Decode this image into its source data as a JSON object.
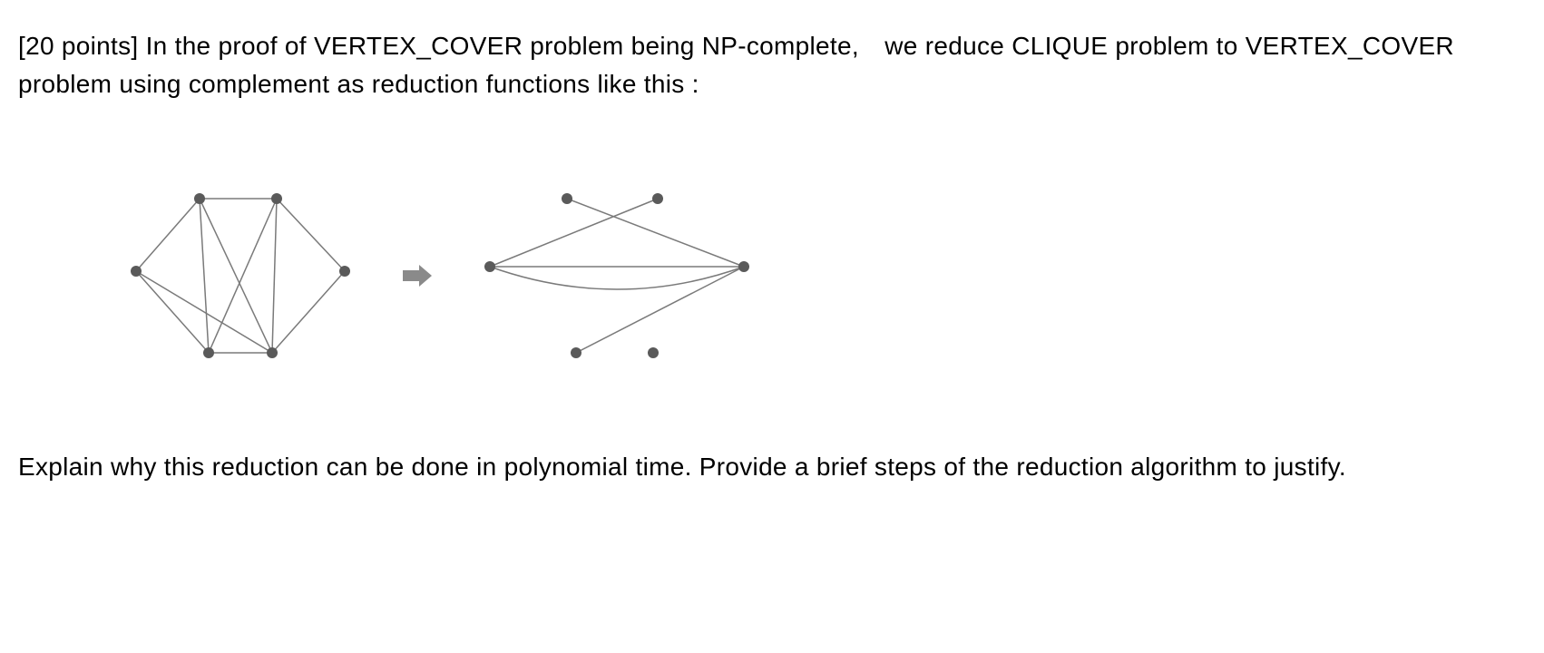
{
  "question": {
    "points_prefix": "[20 points]",
    "line1": "[20 points] In the proof of VERTEX_COVER problem being NP-complete, we reduce CLIQUE problem to VERTEX_COVER problem using complement as reduction functions like this :",
    "line2": "Explain why this reduction can be done in polynomial time. Provide a brief steps of the reduction algorithm to justify."
  },
  "diagram": {
    "graph1": "original-graph",
    "graph2": "complement-graph",
    "arrow": "→"
  }
}
